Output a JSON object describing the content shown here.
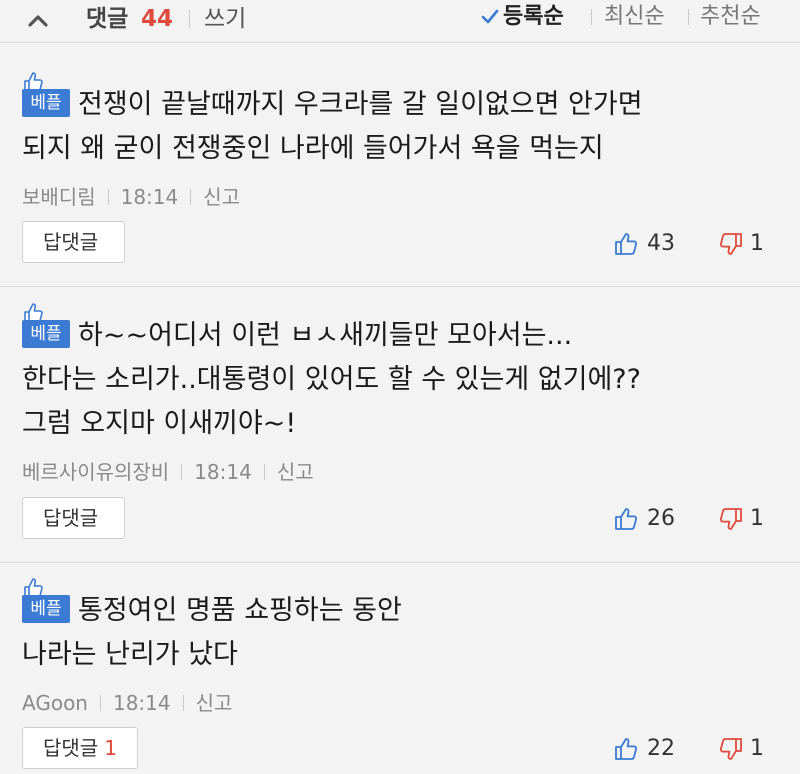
{
  "header": {
    "comment_label": "댓글",
    "comment_count": "44",
    "write_label": "쓰기",
    "sort_options": [
      {
        "label": "등록순",
        "active": true
      },
      {
        "label": "최신순",
        "active": false
      },
      {
        "label": "추천순",
        "active": false
      }
    ]
  },
  "best_badge_label": "베플",
  "colors": {
    "accent_blue": "#3b7bd3",
    "accent_red": "#e04a3c"
  },
  "icons": {
    "collapse": "chevron-up-icon",
    "sort_active": "checkmark-icon",
    "like": "thumbs-up-icon",
    "dislike": "thumbs-down-icon",
    "best": "thumbs-up-icon"
  },
  "comments": [
    {
      "text": "전쟁이 끝날때까지 우크라를 갈 일이없으면 안가면\n되지 왜 굳이 전쟁중인 나라에 들어가서 욕을 먹는지",
      "author": "보배디림",
      "time": "18:14",
      "report_label": "신고",
      "reply_label": "답댓글",
      "reply_count": "",
      "likes": "43",
      "dislikes": "1"
    },
    {
      "text": "하~~어디서 이런 ㅂㅅ새끼들만 모아서는...\n한다는 소리가..대통령이 있어도 할 수 있는게 없기에??\n그럼 오지마 이새끼야~!",
      "author": "베르사이유의장비",
      "time": "18:14",
      "report_label": "신고",
      "reply_label": "답댓글",
      "reply_count": "",
      "likes": "26",
      "dislikes": "1"
    },
    {
      "text": "통정여인 명품 쇼핑하는 동안\n나라는 난리가 났다",
      "author": "AGoon",
      "time": "18:14",
      "report_label": "신고",
      "reply_label": "답댓글",
      "reply_count": "1",
      "likes": "22",
      "dislikes": "1"
    }
  ]
}
